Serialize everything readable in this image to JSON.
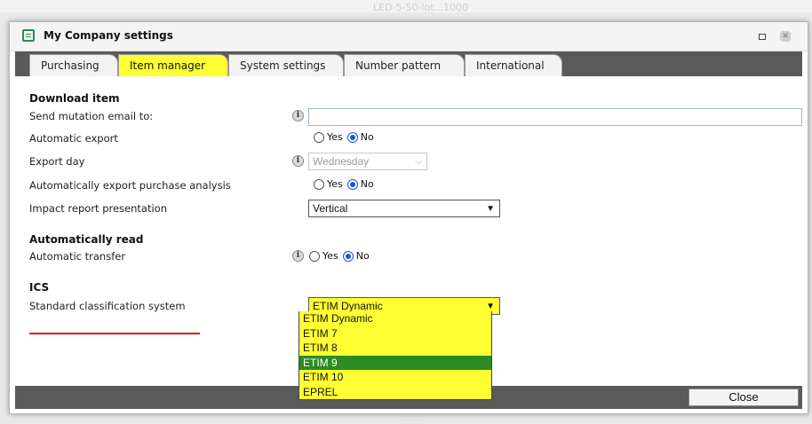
{
  "background": {
    "top_text": "LED-5-50-lot...1000",
    "bottom_text": "........"
  },
  "window": {
    "title": "My Company settings"
  },
  "tabs": [
    {
      "label": "Purchasing",
      "active": false
    },
    {
      "label": "Item manager",
      "active": true
    },
    {
      "label": "System settings",
      "active": false
    },
    {
      "label": "Number pattern",
      "active": false
    },
    {
      "label": "International",
      "active": false
    }
  ],
  "sections": {
    "download": "Download item",
    "auto_read": "Automatically read",
    "ics": "ICS"
  },
  "fields": {
    "send_mutation_email": {
      "label": "Send mutation email to:",
      "value": ""
    },
    "automatic_export": {
      "label": "Automatic export",
      "yes": "Yes",
      "no": "No",
      "selected": "No"
    },
    "export_day": {
      "label": "Export day",
      "value": "Wednesday",
      "disabled": true
    },
    "auto_export_purchase": {
      "label": "Automatically export purchase analysis",
      "yes": "Yes",
      "no": "No",
      "selected": "No"
    },
    "impact_report": {
      "label": "Impact report presentation",
      "value": "Vertical"
    },
    "automatic_transfer": {
      "label": "Automatic transfer",
      "yes": "Yes",
      "no": "No",
      "selected": "No"
    },
    "classification": {
      "label": "Standard classification system",
      "value": "ETIM Dynamic",
      "options": [
        "ETIM Dynamic",
        "ETIM 7",
        "ETIM 8",
        "ETIM 9",
        "ETIM 10",
        "EPREL"
      ],
      "highlighted": "ETIM 9"
    }
  },
  "footer": {
    "close_label": "Close"
  },
  "colors": {
    "active_tab": "#ffff33",
    "dropdown_bg": "#ffff33",
    "dropdown_highlight": "#2b8a22",
    "bar": "#5a5a5a",
    "underline": "#dd1111"
  }
}
